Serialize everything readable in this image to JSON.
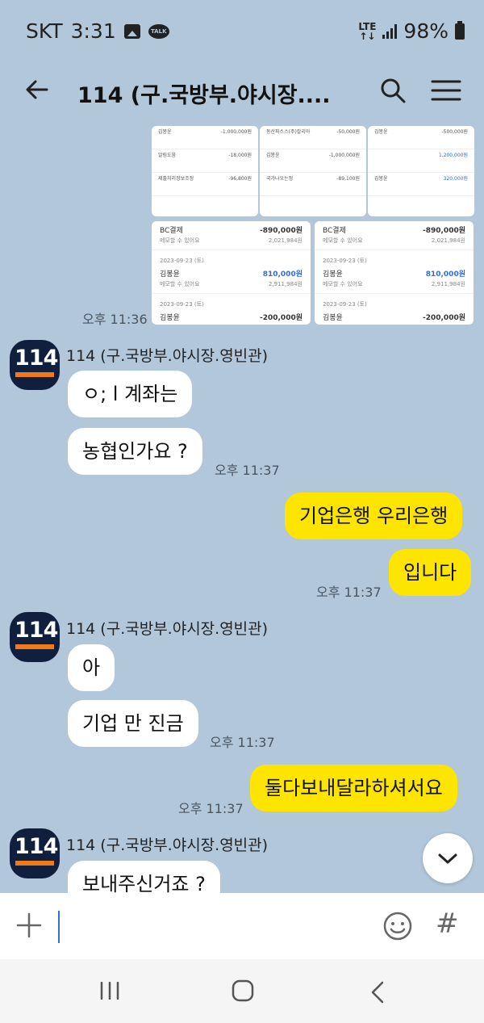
{
  "status_bar": {
    "carrier": "SKT",
    "time": "3:31",
    "talk_icon_text": "TALK",
    "network": "LTE",
    "battery": "98%"
  },
  "header": {
    "title": "114 (구.국방부.야시장...."
  },
  "thumbnails": {
    "top": [
      {
        "rows": [
          [
            "김봉윤",
            "-1,000,000원"
          ],
          [
            "알림도움",
            "-18,000원"
          ],
          [
            "제출처리정보조정",
            "-96,800원"
          ]
        ]
      },
      {
        "rows": [
          [
            "동산파스스(주)칼리아",
            "-50,000원"
          ],
          [
            "김봉윤",
            "-1,000,000원"
          ],
          [
            "국가나오는정",
            "-89,100원"
          ]
        ]
      },
      {
        "rows": [
          [
            "김봉윤",
            "-500,000원"
          ],
          [
            "",
            "1,200,000원"
          ],
          [
            "김봉윤",
            "320,000원"
          ]
        ]
      }
    ],
    "big": [
      {
        "r1_label": "BC결제",
        "r1_amount": "-890,000원",
        "r1_sub": "메모할 수 있어요",
        "r1_balance": "2,021,984원",
        "date": "2023-09-23 (토)",
        "r2_label": "김봉윤",
        "r2_amount": "810,000원",
        "r2_sub": "메모할 수 있어요",
        "r2_balance": "2,911,984원",
        "date2": "2023-09-23 (토)",
        "r3_label": "김봉윤",
        "r3_amount": "-200,000원"
      },
      {
        "r1_label": "BC결제",
        "r1_amount": "-890,000원",
        "r1_sub": "메모할 수 있어요",
        "r1_balance": "2,021,984원",
        "date": "2023-09-23 (토)",
        "r2_label": "김봉윤",
        "r2_amount": "810,000원",
        "r2_sub": "메모할 수 있어요",
        "r2_balance": "2,911,984원",
        "date2": "2023-09-23 (토)",
        "r3_label": "김봉윤",
        "r3_amount": "-200,000원"
      }
    ]
  },
  "messages": {
    "time_images": "오후 11:36",
    "sender_name": "114 (구.국방부.야시장.영빈관)",
    "m1": "ㅇ; l 계좌는",
    "m2": "농협인가요 ?",
    "time_m2": "오후 11:37",
    "m3": "기업은행 우리은행",
    "m4": "입니다",
    "time_m4": "오후 11:37",
    "m5": "아",
    "m6": "기업 만 진금",
    "time_m6": "오후 11:37",
    "m7": "둘다보내달라하셔서요",
    "time_m7": "오후 11:37",
    "m8": "보내주신거죠 ?"
  },
  "input": {
    "hash": "#"
  },
  "colors": {
    "chat_bg": "#b2c7da",
    "my_bubble": "#fee500",
    "their_bubble": "#ffffff"
  }
}
